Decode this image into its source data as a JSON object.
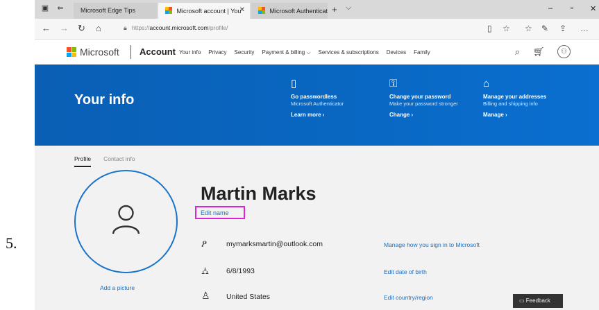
{
  "step_number": "5.",
  "browser": {
    "tabs": [
      {
        "label": "Microsoft Edge Tips",
        "active": false,
        "closable": false
      },
      {
        "label": "Microsoft account | You",
        "active": true,
        "closable": true
      },
      {
        "label": "Microsoft Authenticator – S",
        "active": false,
        "closable": false
      }
    ],
    "url_prefix": "https://",
    "url_host": "account.microsoft.com",
    "url_path": "/profile/"
  },
  "header": {
    "brand": "Microsoft",
    "section": "Account",
    "nav": [
      "Your info",
      "Privacy",
      "Security",
      "Payment & billing ⌵",
      "Services & subscriptions",
      "Devices",
      "Family"
    ]
  },
  "banner": {
    "title": "Your info",
    "promos": [
      {
        "icon": "phone-icon",
        "heading": "Go passwordless",
        "desc": "Microsoft Authenticator",
        "link": "Learn more ›"
      },
      {
        "icon": "key-icon",
        "heading": "Change your password",
        "desc": "Make your password stronger",
        "link": "Change ›"
      },
      {
        "icon": "home-icon",
        "heading": "Manage your addresses",
        "desc": "Billing and shipping info",
        "link": "Manage ›"
      }
    ]
  },
  "profile": {
    "tabs": [
      "Profile",
      "Contact info"
    ],
    "add_picture": "Add a picture",
    "name": "Martin Marks",
    "edit_name": "Edit name",
    "rows": [
      {
        "icon": "person-icon",
        "value": "mymarksmartin@outlook.com",
        "action": "Manage how you sign in to Microsoft"
      },
      {
        "icon": "cake-icon",
        "value": "6/8/1993",
        "action": "Edit date of birth"
      },
      {
        "icon": "globe-person-icon",
        "value": "United States",
        "action": "Edit country/region"
      }
    ],
    "feedback": "Feedback"
  },
  "colors": {
    "banner": "#0967c2",
    "link": "#1a6fc4",
    "highlight": "#e022d6"
  }
}
